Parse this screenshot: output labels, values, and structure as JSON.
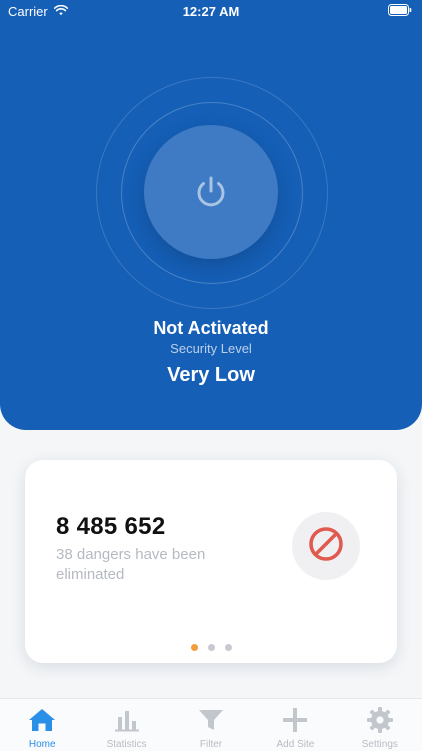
{
  "status_bar": {
    "carrier": "Carrier",
    "time": "12:27 AM"
  },
  "hero": {
    "title": "Not Activated",
    "security_label": "Security Level",
    "security_value": "Very Low",
    "background_color": "#155fb7",
    "power_icon": "power-icon"
  },
  "card": {
    "count": "8 485 652",
    "caption": "38 dangers have been eliminated",
    "badge_icon": "blocked-icon",
    "pager": {
      "total": 3,
      "active_index": 0,
      "active_color": "#f39c3d"
    }
  },
  "tabbar": {
    "tabs": [
      {
        "label": "Home",
        "icon": "home-icon",
        "active": true
      },
      {
        "label": "Statistics",
        "icon": "bar-chart-icon",
        "active": false
      },
      {
        "label": "Filter",
        "icon": "filter-icon",
        "active": false
      },
      {
        "label": "Add Site",
        "icon": "plus-icon",
        "active": false
      },
      {
        "label": "Settings",
        "icon": "gear-icon",
        "active": false
      }
    ],
    "active_color": "#2a8fe6",
    "inactive_color": "#b8bcc3"
  }
}
